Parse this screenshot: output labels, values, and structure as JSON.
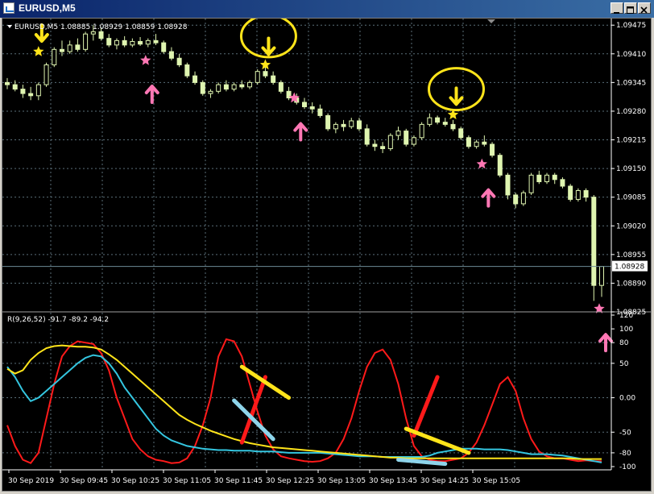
{
  "window": {
    "title": "EURUSD,M5"
  },
  "main_header": "EURUSD,M5  1.08885 1.08929 1.08859 1.08928",
  "indicator_header": "R(9,26,52) -91.7 -89.2 -94.2",
  "current_price": "1.08928",
  "colors": {
    "background": "#000000",
    "grid": "#5a6e78",
    "bull": "#dff5b0",
    "bear": "#dff5b0",
    "star_sell": "#ffe41a",
    "star_buy": "#ff77b4",
    "arrow_sell": "#ffe41a",
    "arrow_buy": "#ff77b4",
    "circle": "#ffe41a",
    "ind_red": "#ff1a1a",
    "ind_cyan": "#34c6e0",
    "ind_yellow": "#ffe41a"
  },
  "chart_data": [
    {
      "type": "candlestick",
      "title": "EURUSD,M5",
      "y_ticks": [
        "1.09475",
        "1.09410",
        "1.09345",
        "1.09280",
        "1.09215",
        "1.09150",
        "1.09085",
        "1.09020",
        "1.08955",
        "1.08890",
        "1.08825"
      ],
      "ylim": [
        1.08825,
        1.0949
      ],
      "y_grid_step": 0.000325,
      "x_ticks": [
        "30 Sep 2019",
        "30 Sep 09:45",
        "30 Sep 10:25",
        "30 Sep 11:05",
        "30 Sep 11:45",
        "30 Sep 12:25",
        "30 Sep 13:05",
        "30 Sep 13:45",
        "30 Sep 14:25",
        "30 Sep 15:05"
      ],
      "candles": [
        {
          "o": 1.09345,
          "h": 1.09355,
          "l": 1.0933,
          "c": 1.0934
        },
        {
          "o": 1.0934,
          "h": 1.0935,
          "l": 1.09325,
          "c": 1.0933
        },
        {
          "o": 1.0933,
          "h": 1.0934,
          "l": 1.0931,
          "c": 1.0932
        },
        {
          "o": 1.0932,
          "h": 1.09335,
          "l": 1.09305,
          "c": 1.09315
        },
        {
          "o": 1.09315,
          "h": 1.09345,
          "l": 1.09305,
          "c": 1.0934
        },
        {
          "o": 1.0934,
          "h": 1.0939,
          "l": 1.09335,
          "c": 1.09385
        },
        {
          "o": 1.09385,
          "h": 1.09425,
          "l": 1.0938,
          "c": 1.0942
        },
        {
          "o": 1.0942,
          "h": 1.0944,
          "l": 1.09405,
          "c": 1.09415
        },
        {
          "o": 1.09415,
          "h": 1.0944,
          "l": 1.0941,
          "c": 1.0943
        },
        {
          "o": 1.0943,
          "h": 1.09445,
          "l": 1.09415,
          "c": 1.0942
        },
        {
          "o": 1.0942,
          "h": 1.0946,
          "l": 1.09415,
          "c": 1.09455
        },
        {
          "o": 1.09455,
          "h": 1.09475,
          "l": 1.0944,
          "c": 1.0946
        },
        {
          "o": 1.0946,
          "h": 1.0947,
          "l": 1.0944,
          "c": 1.09445
        },
        {
          "o": 1.09445,
          "h": 1.09455,
          "l": 1.09425,
          "c": 1.0943
        },
        {
          "o": 1.0943,
          "h": 1.09445,
          "l": 1.0942,
          "c": 1.0944
        },
        {
          "o": 1.0944,
          "h": 1.0945,
          "l": 1.09425,
          "c": 1.0943
        },
        {
          "o": 1.0943,
          "h": 1.09445,
          "l": 1.09425,
          "c": 1.09438
        },
        {
          "o": 1.09438,
          "h": 1.09448,
          "l": 1.09428,
          "c": 1.09432
        },
        {
          "o": 1.09432,
          "h": 1.09445,
          "l": 1.09425,
          "c": 1.0944
        },
        {
          "o": 1.0944,
          "h": 1.09455,
          "l": 1.0943,
          "c": 1.09435
        },
        {
          "o": 1.09435,
          "h": 1.0944,
          "l": 1.0941,
          "c": 1.09415
        },
        {
          "o": 1.09415,
          "h": 1.09425,
          "l": 1.09395,
          "c": 1.094
        },
        {
          "o": 1.094,
          "h": 1.0941,
          "l": 1.0938,
          "c": 1.09385
        },
        {
          "o": 1.09385,
          "h": 1.0939,
          "l": 1.09355,
          "c": 1.0936
        },
        {
          "o": 1.0936,
          "h": 1.0937,
          "l": 1.0934,
          "c": 1.09345
        },
        {
          "o": 1.09345,
          "h": 1.0935,
          "l": 1.09315,
          "c": 1.0932
        },
        {
          "o": 1.0932,
          "h": 1.0933,
          "l": 1.0931,
          "c": 1.09325
        },
        {
          "o": 1.09325,
          "h": 1.09345,
          "l": 1.0932,
          "c": 1.0934
        },
        {
          "o": 1.0934,
          "h": 1.0935,
          "l": 1.09325,
          "c": 1.0933
        },
        {
          "o": 1.0933,
          "h": 1.09345,
          "l": 1.09325,
          "c": 1.0934
        },
        {
          "o": 1.0934,
          "h": 1.0935,
          "l": 1.0933,
          "c": 1.09335
        },
        {
          "o": 1.09335,
          "h": 1.0935,
          "l": 1.0933,
          "c": 1.09345
        },
        {
          "o": 1.09345,
          "h": 1.09375,
          "l": 1.0934,
          "c": 1.0937
        },
        {
          "o": 1.0937,
          "h": 1.0938,
          "l": 1.09355,
          "c": 1.0936
        },
        {
          "o": 1.0936,
          "h": 1.0937,
          "l": 1.0934,
          "c": 1.09345
        },
        {
          "o": 1.09345,
          "h": 1.0935,
          "l": 1.0932,
          "c": 1.09325
        },
        {
          "o": 1.09325,
          "h": 1.09335,
          "l": 1.09305,
          "c": 1.0931
        },
        {
          "o": 1.0931,
          "h": 1.0932,
          "l": 1.09295,
          "c": 1.093
        },
        {
          "o": 1.093,
          "h": 1.0931,
          "l": 1.09285,
          "c": 1.0929
        },
        {
          "o": 1.0929,
          "h": 1.093,
          "l": 1.09275,
          "c": 1.09285
        },
        {
          "o": 1.09285,
          "h": 1.09295,
          "l": 1.09265,
          "c": 1.0927
        },
        {
          "o": 1.0927,
          "h": 1.09275,
          "l": 1.09235,
          "c": 1.0924
        },
        {
          "o": 1.0924,
          "h": 1.09255,
          "l": 1.0923,
          "c": 1.0925
        },
        {
          "o": 1.0925,
          "h": 1.0926,
          "l": 1.09235,
          "c": 1.09245
        },
        {
          "o": 1.09245,
          "h": 1.09265,
          "l": 1.0924,
          "c": 1.09258
        },
        {
          "o": 1.09258,
          "h": 1.09265,
          "l": 1.09235,
          "c": 1.0924
        },
        {
          "o": 1.0924,
          "h": 1.0925,
          "l": 1.092,
          "c": 1.09205
        },
        {
          "o": 1.09205,
          "h": 1.09215,
          "l": 1.0919,
          "c": 1.092
        },
        {
          "o": 1.092,
          "h": 1.0921,
          "l": 1.09185,
          "c": 1.09195
        },
        {
          "o": 1.09195,
          "h": 1.0923,
          "l": 1.0919,
          "c": 1.09225
        },
        {
          "o": 1.09225,
          "h": 1.09245,
          "l": 1.09215,
          "c": 1.09235
        },
        {
          "o": 1.09235,
          "h": 1.0924,
          "l": 1.092,
          "c": 1.09205
        },
        {
          "o": 1.09205,
          "h": 1.09225,
          "l": 1.092,
          "c": 1.0922
        },
        {
          "o": 1.0922,
          "h": 1.09255,
          "l": 1.09215,
          "c": 1.0925
        },
        {
          "o": 1.0925,
          "h": 1.09275,
          "l": 1.09245,
          "c": 1.09265
        },
        {
          "o": 1.09265,
          "h": 1.0927,
          "l": 1.0925,
          "c": 1.09255
        },
        {
          "o": 1.09255,
          "h": 1.09265,
          "l": 1.09245,
          "c": 1.0925
        },
        {
          "o": 1.0925,
          "h": 1.0926,
          "l": 1.09235,
          "c": 1.0924
        },
        {
          "o": 1.0924,
          "h": 1.09245,
          "l": 1.09215,
          "c": 1.0922
        },
        {
          "o": 1.0922,
          "h": 1.09225,
          "l": 1.09195,
          "c": 1.092
        },
        {
          "o": 1.092,
          "h": 1.09215,
          "l": 1.09195,
          "c": 1.0921
        },
        {
          "o": 1.0921,
          "h": 1.09225,
          "l": 1.092,
          "c": 1.09205
        },
        {
          "o": 1.09205,
          "h": 1.0921,
          "l": 1.09175,
          "c": 1.0918
        },
        {
          "o": 1.0918,
          "h": 1.09185,
          "l": 1.0913,
          "c": 1.09135
        },
        {
          "o": 1.09135,
          "h": 1.0914,
          "l": 1.0908,
          "c": 1.0909
        },
        {
          "o": 1.0909,
          "h": 1.09095,
          "l": 1.0906,
          "c": 1.0907
        },
        {
          "o": 1.0907,
          "h": 1.091,
          "l": 1.09065,
          "c": 1.09095
        },
        {
          "o": 1.09095,
          "h": 1.0914,
          "l": 1.0909,
          "c": 1.09135
        },
        {
          "o": 1.09135,
          "h": 1.09145,
          "l": 1.09115,
          "c": 1.0912
        },
        {
          "o": 1.0912,
          "h": 1.0914,
          "l": 1.09115,
          "c": 1.09135
        },
        {
          "o": 1.09135,
          "h": 1.0914,
          "l": 1.09115,
          "c": 1.09125
        },
        {
          "o": 1.09125,
          "h": 1.0913,
          "l": 1.09105,
          "c": 1.0911
        },
        {
          "o": 1.0911,
          "h": 1.09115,
          "l": 1.09075,
          "c": 1.0908
        },
        {
          "o": 1.0908,
          "h": 1.09105,
          "l": 1.09075,
          "c": 1.091
        },
        {
          "o": 1.091,
          "h": 1.09105,
          "l": 1.09075,
          "c": 1.09085
        },
        {
          "o": 1.09085,
          "h": 1.0909,
          "l": 1.0885,
          "c": 1.08885
        },
        {
          "o": 1.08885,
          "h": 1.08929,
          "l": 1.08859,
          "c": 1.08928
        }
      ],
      "sell_signals": [
        {
          "i": 4,
          "at": 1.09415
        },
        {
          "i": 33,
          "at": 1.09385
        },
        {
          "i": 57,
          "at": 1.09272
        }
      ],
      "buy_signals": [
        {
          "i": 18,
          "at": 1.09395
        },
        {
          "i": 37,
          "at": 1.0931
        },
        {
          "i": 61,
          "at": 1.0916
        },
        {
          "i": 76,
          "at": 1.08832
        }
      ],
      "circles": [
        {
          "i": 33,
          "at": 1.0945
        },
        {
          "i": 57,
          "at": 1.0933
        }
      ]
    },
    {
      "type": "line",
      "title": "R(9,26,52)",
      "y_ticks": [
        "120",
        "100",
        "80",
        "50",
        "0.00",
        "-50",
        "-80",
        "-100"
      ],
      "ylim": [
        -100,
        120
      ],
      "series": [
        {
          "values": [
            -40,
            -70,
            -90,
            -95,
            -80,
            -30,
            20,
            60,
            75,
            82,
            80,
            78,
            65,
            40,
            0,
            -30,
            -60,
            -75,
            -85,
            -90,
            -92,
            -95,
            -94,
            -88,
            -70,
            -40,
            0,
            60,
            85,
            82,
            60,
            20,
            -20,
            -55,
            -75,
            -85,
            -88,
            -90,
            -92,
            -93,
            -92,
            -88,
            -80,
            -60,
            -30,
            10,
            45,
            65,
            70,
            55,
            20,
            -30,
            -70,
            -85,
            -90,
            -92,
            -92,
            -90,
            -88,
            -80,
            -65,
            -40,
            -10,
            20,
            30,
            10,
            -30,
            -60,
            -78,
            -85,
            -88,
            -88,
            -90,
            -92,
            -91,
            -92,
            -92
          ]
        },
        {
          "values": [
            45,
            30,
            10,
            -5,
            0,
            10,
            20,
            30,
            40,
            50,
            58,
            62,
            60,
            50,
            35,
            15,
            0,
            -15,
            -30,
            -45,
            -55,
            -62,
            -66,
            -70,
            -72,
            -74,
            -75,
            -76,
            -76,
            -77,
            -77,
            -77,
            -78,
            -78,
            -78,
            -79,
            -80,
            -80,
            -80,
            -80,
            -80,
            -81,
            -82,
            -83,
            -84,
            -85,
            -85,
            -85,
            -86,
            -86,
            -86,
            -86,
            -86,
            -86,
            -84,
            -80,
            -78,
            -76,
            -74,
            -74,
            -74,
            -75,
            -75,
            -75,
            -76,
            -78,
            -80,
            -82,
            -82,
            -82,
            -83,
            -84,
            -86,
            -88,
            -90,
            -92,
            -94
          ]
        },
        {
          "values": [
            42,
            35,
            40,
            55,
            65,
            72,
            75,
            76,
            75,
            74,
            74,
            73,
            70,
            63,
            55,
            45,
            35,
            25,
            15,
            5,
            -5,
            -15,
            -25,
            -32,
            -38,
            -43,
            -48,
            -52,
            -56,
            -60,
            -63,
            -66,
            -68,
            -70,
            -72,
            -73,
            -74,
            -75,
            -76,
            -77,
            -78,
            -79,
            -80,
            -81,
            -82,
            -83,
            -84,
            -85,
            -86,
            -87,
            -87,
            -88,
            -88,
            -88,
            -88,
            -88,
            -88,
            -88,
            -88,
            -88,
            -88,
            -88,
            -88,
            -88,
            -88,
            -88,
            -88,
            -88,
            -88,
            -88,
            -88,
            -88,
            -88,
            -89,
            -89,
            -89,
            -89
          ]
        }
      ],
      "annotations": [
        {
          "kind": "red-line",
          "from": [
            30,
            -65
          ],
          "to": [
            33,
            30
          ]
        },
        {
          "kind": "yellow-line",
          "from": [
            30,
            45
          ],
          "to": [
            36,
            0
          ]
        },
        {
          "kind": "blue-line",
          "from": [
            29,
            -4
          ],
          "to": [
            34,
            -60
          ]
        },
        {
          "kind": "red-line",
          "from": [
            52,
            -55
          ],
          "to": [
            55,
            30
          ]
        },
        {
          "kind": "yellow-line",
          "from": [
            51,
            -45
          ],
          "to": [
            59,
            -80
          ]
        },
        {
          "kind": "blue-line",
          "from": [
            50,
            -90
          ],
          "to": [
            56,
            -96
          ]
        }
      ]
    }
  ]
}
